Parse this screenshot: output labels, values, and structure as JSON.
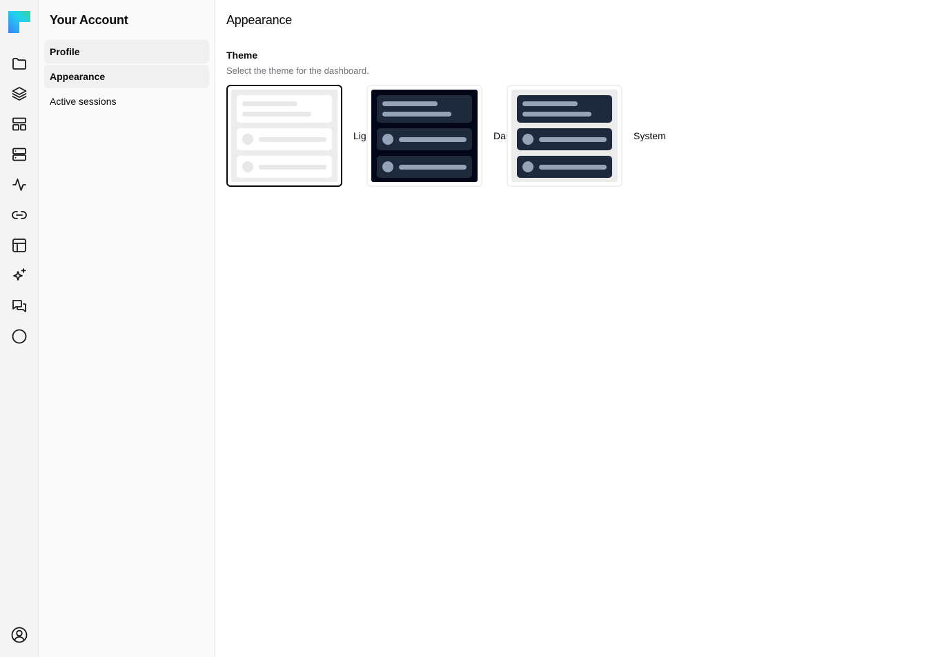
{
  "rail": {
    "items": [
      {
        "icon": "folder-icon"
      },
      {
        "icon": "layers-icon"
      },
      {
        "icon": "layout-icon"
      },
      {
        "icon": "server-icon"
      },
      {
        "icon": "activity-icon"
      },
      {
        "icon": "link-icon"
      },
      {
        "icon": "table-icon"
      },
      {
        "icon": "sparkles-icon"
      },
      {
        "icon": "messages-icon"
      },
      {
        "icon": "circle-icon"
      }
    ],
    "user_icon": "user-icon",
    "logo_colors": [
      "#3b82f6",
      "#22d3ee",
      "#34d399"
    ]
  },
  "account": {
    "title": "Your Account",
    "nav": [
      {
        "label": "Profile",
        "active": true
      },
      {
        "label": "Appearance",
        "active": true
      },
      {
        "label": "Active sessions",
        "active": false
      }
    ]
  },
  "main": {
    "title": "Appearance",
    "theme": {
      "title": "Theme",
      "description": "Select the theme for the dashboard.",
      "options": [
        {
          "label": "Lig",
          "variant": "light",
          "selected": true
        },
        {
          "label": "Dar",
          "variant": "dark",
          "selected": false
        },
        {
          "label": "System",
          "variant": "system",
          "selected": false
        }
      ]
    }
  }
}
